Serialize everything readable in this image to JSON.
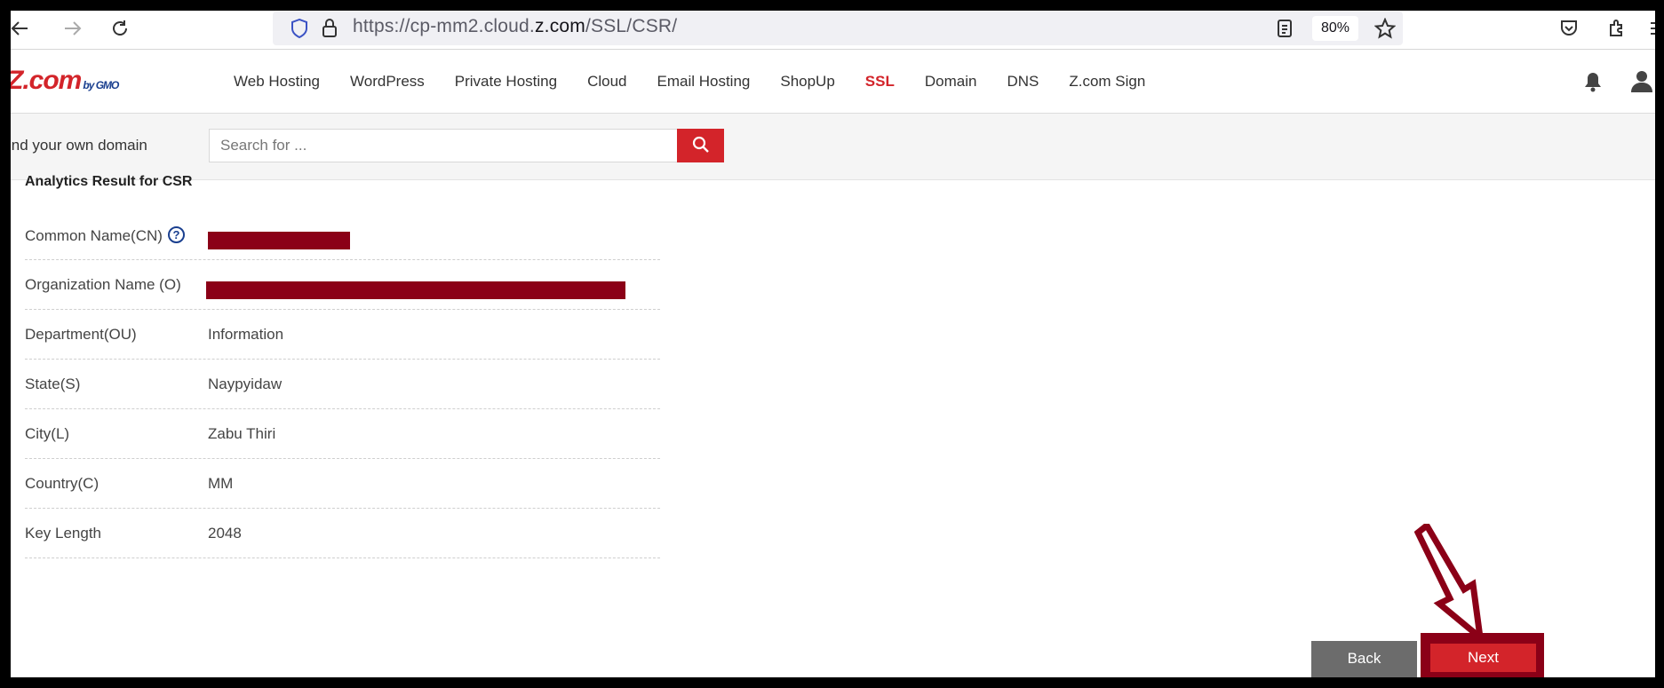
{
  "browser": {
    "url_prefix": "https://cp-mm2.cloud.",
    "url_domain": "z.com",
    "url_path": "/SSL/CSR/",
    "zoom": "80%"
  },
  "header": {
    "logo_text": "Z.com",
    "logo_sub": "by GMO",
    "nav": [
      "Web Hosting",
      "WordPress",
      "Private Hosting",
      "Cloud",
      "Email Hosting",
      "ShopUp",
      "SSL",
      "Domain",
      "DNS",
      "Z.com Sign"
    ],
    "active_nav": "SSL"
  },
  "search": {
    "label": "ind your own domain",
    "placeholder": "Search for ..."
  },
  "result": {
    "title": "Analytics Result for CSR",
    "rows": [
      {
        "label": "Common Name(CN)",
        "value": ""
      },
      {
        "label": "Organization Name (O)",
        "value": ""
      },
      {
        "label": "Department(OU)",
        "value": "Information"
      },
      {
        "label": "State(S)",
        "value": "Naypyidaw"
      },
      {
        "label": "City(L)",
        "value": "Zabu Thiri"
      },
      {
        "label": "Country(C)",
        "value": "MM"
      },
      {
        "label": "Key Length",
        "value": "2048"
      }
    ]
  },
  "actions": {
    "back_label": "Back",
    "next_label": "Next"
  },
  "colors": {
    "brand_red": "#d3242a",
    "annotation": "#8b0017"
  }
}
